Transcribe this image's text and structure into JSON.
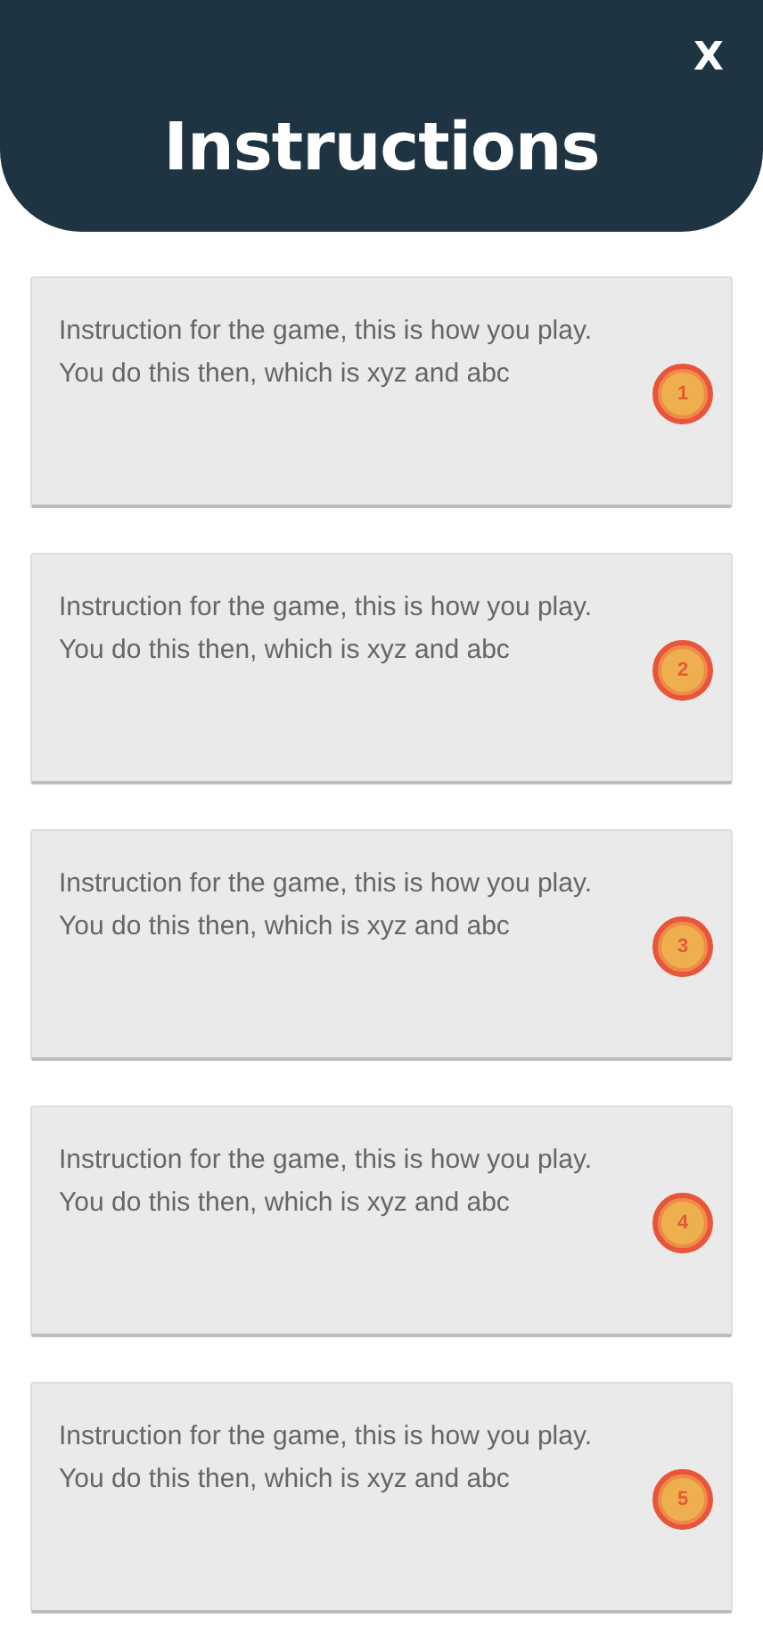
{
  "header": {
    "title": "Instructions",
    "close": "X"
  },
  "cards": [
    {
      "text": "Instruction for the game, this is how you play.\nYou do this then, which is xyz and abc",
      "badge": "1"
    },
    {
      "text": "Instruction for the game, this is how you play.\nYou do this then, which is xyz and abc",
      "badge": "2"
    },
    {
      "text": "Instruction for the game, this is how you play.\nYou do this then, which is xyz and abc",
      "badge": "3"
    },
    {
      "text": "Instruction for the game, this is how you play.\nYou do this then, which is xyz and abc",
      "badge": "4"
    },
    {
      "text": "Instruction for the game, this is how you play.\nYou do this then, which is xyz and abc",
      "badge": "5"
    }
  ]
}
